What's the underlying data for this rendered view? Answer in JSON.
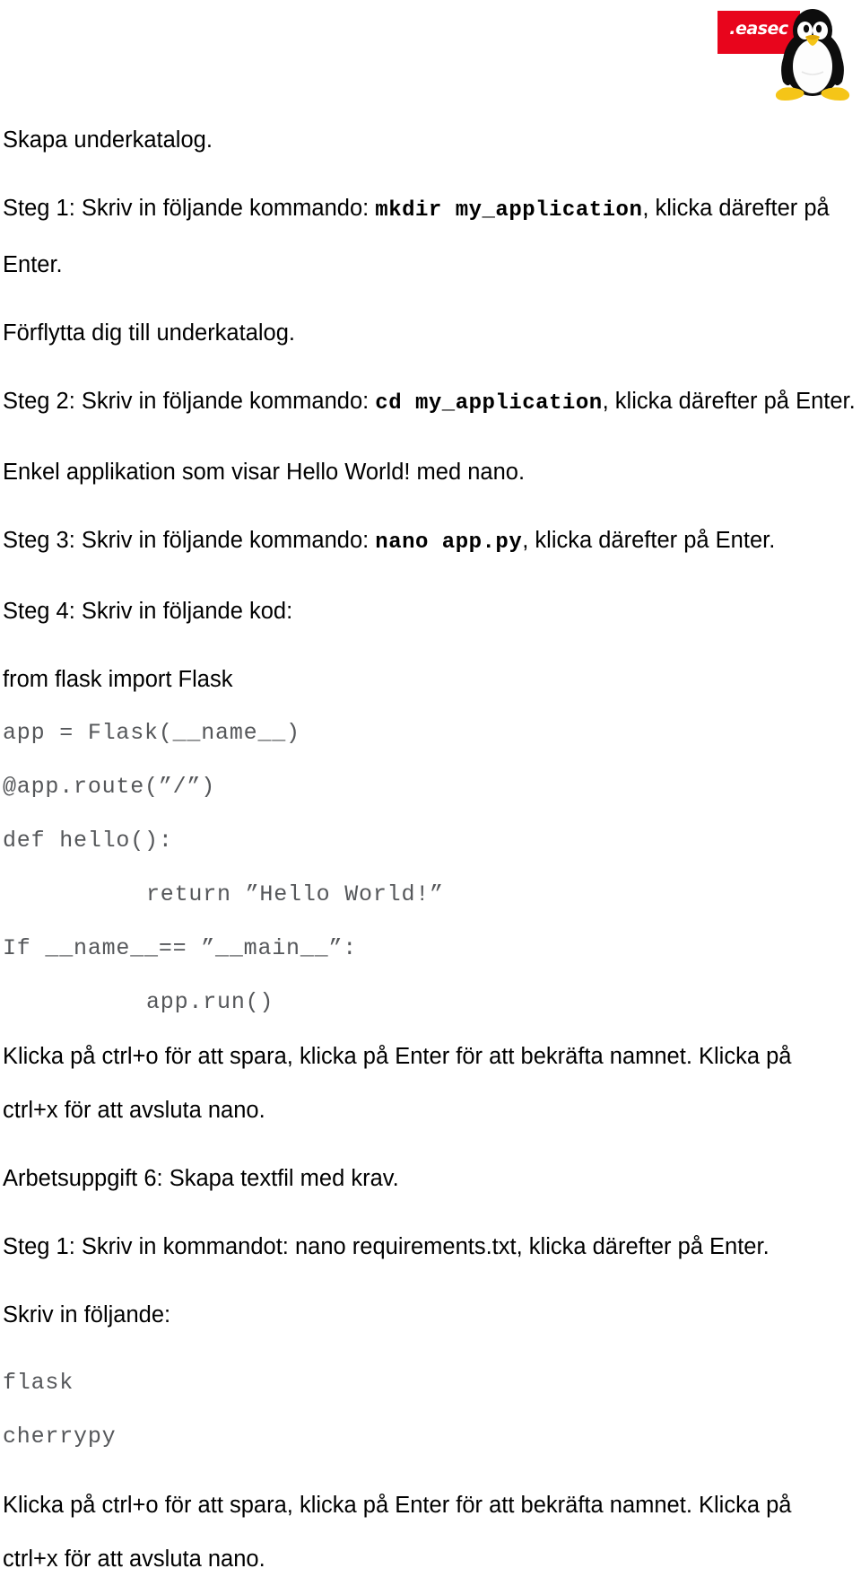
{
  "logo": {
    "brand_text": ".easec",
    "brand_color": "#e8051c",
    "mascot": "tux-penguin"
  },
  "document": {
    "sections": [
      {
        "heading": "Skapa underkatalog.",
        "step_prefix": "Steg 1: Skriv in följande kommando: ",
        "command": "mkdir my_application",
        "step_suffix": ", klicka därefter på Enter."
      },
      {
        "heading": "Förflytta dig till underkatalog.",
        "step_prefix": "Steg 2: Skriv in följande kommando: ",
        "command": "cd my_application",
        "step_suffix": ", klicka därefter på Enter."
      },
      {
        "heading": "Enkel applikation som visar Hello World! med nano.",
        "step_prefix": "Steg 3: Skriv in följande kommando: ",
        "command": "nano app.py",
        "step_suffix": ", klicka därefter på Enter."
      }
    ],
    "step4_label": "Steg 4: Skriv in följande kod:",
    "code_lines": [
      {
        "text": "from flask import Flask",
        "style": "sans"
      },
      {
        "text": "app = Flask(__name__)",
        "style": "mono"
      },
      {
        "text": "@app.route(”/”)",
        "style": "mono"
      },
      {
        "text": "def hello():",
        "style": "mono"
      },
      {
        "text": "return ”Hello World!”",
        "style": "mono-indent"
      },
      {
        "text": "If __name__== ”__main__”:",
        "style": "mono"
      },
      {
        "text": "app.run()",
        "style": "mono-indent"
      }
    ],
    "save_note_line1": "Klicka på ctrl+o för att spara, klicka på Enter för att bekräfta namnet. Klicka på",
    "save_note_line2": "ctrl+x för att avsluta nano.",
    "task6_heading": "Arbetsuppgift 6: Skapa textfil med krav.",
    "task6_step1": "Steg 1: Skriv in kommandot: nano requirements.txt, klicka därefter på Enter.",
    "task6_write_label": "Skriv in följande:",
    "requirements": [
      "flask",
      "cherrypy"
    ],
    "save_note2_line1": "Klicka på ctrl+o för att spara, klicka på Enter för att bekräfta namnet. Klicka på",
    "save_note2_line2": "ctrl+x för att avsluta nano."
  }
}
